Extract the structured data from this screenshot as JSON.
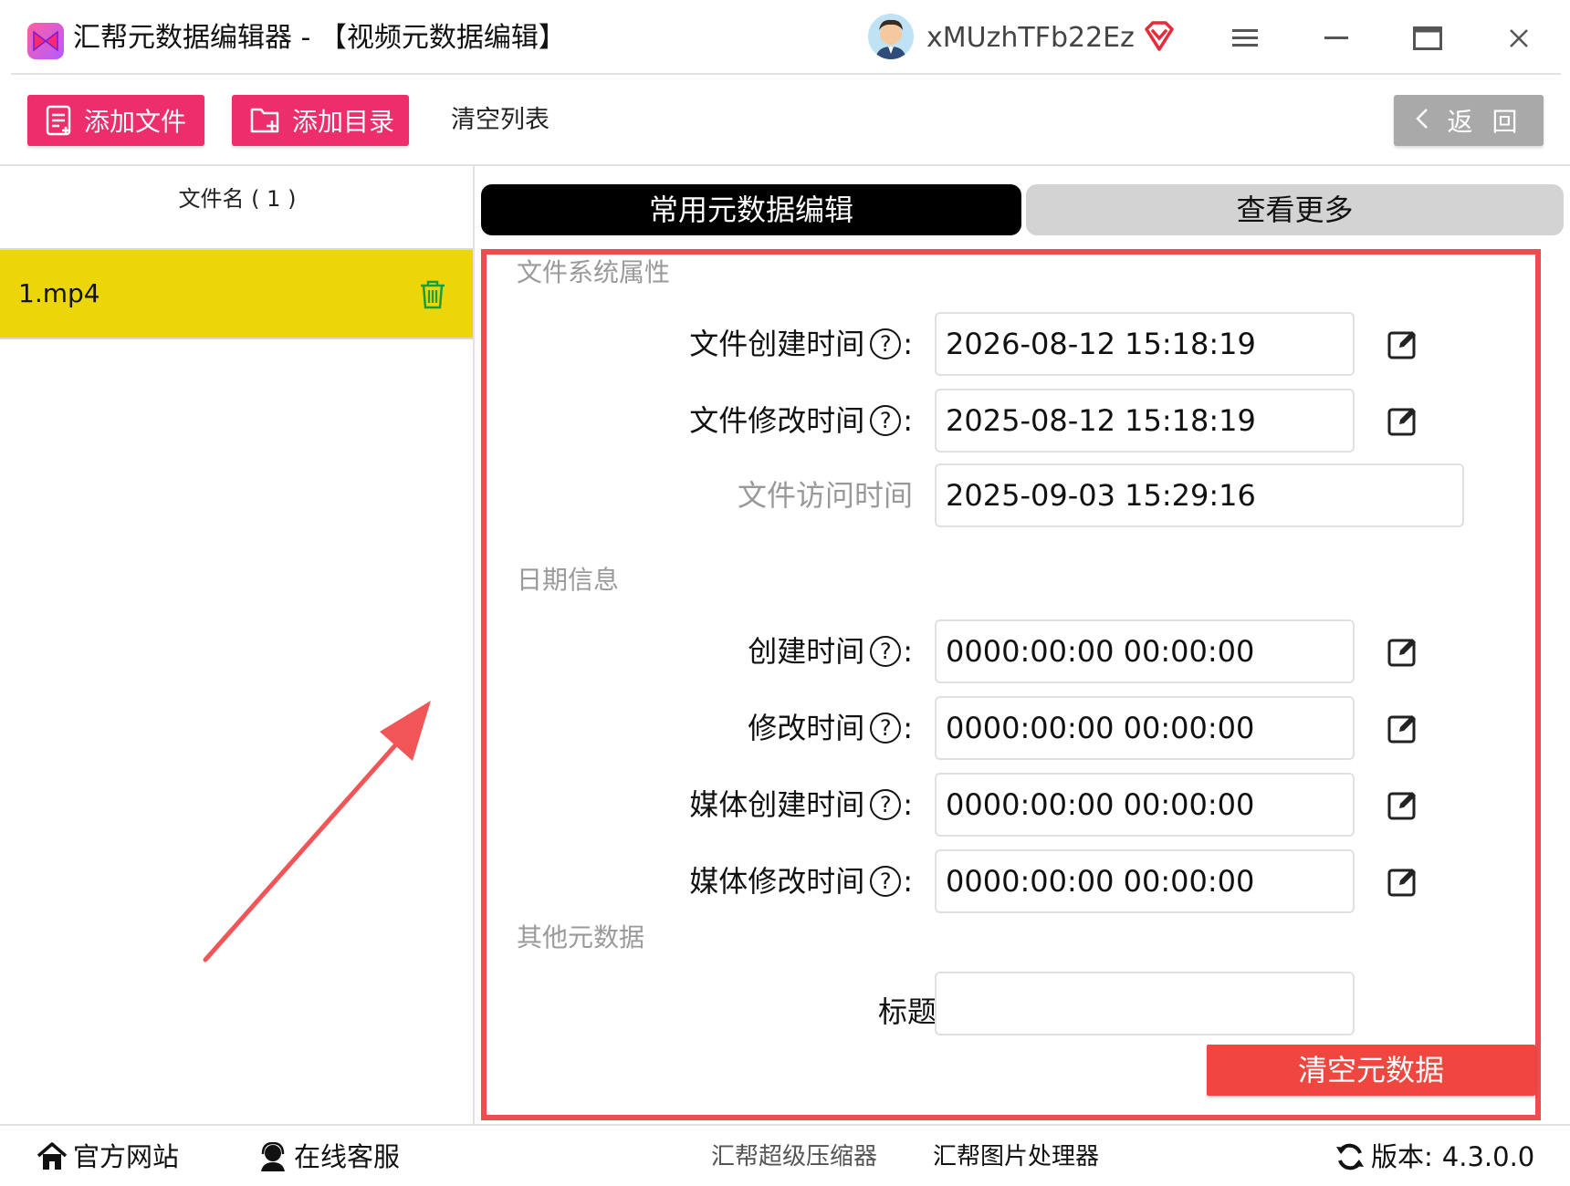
{
  "window": {
    "title": "汇帮元数据编辑器 - 【视频元数据编辑】",
    "username": "xMUzhTFb22Ez"
  },
  "toolbar": {
    "add_file": "添加文件",
    "add_folder": "添加目录",
    "clear_list": "清空列表",
    "back": "返 回"
  },
  "file_list": {
    "header": "文件名 ( 1 )",
    "items": [
      {
        "name": "1.mp4"
      }
    ]
  },
  "tabs": {
    "common": "常用元数据编辑",
    "more": "查看更多"
  },
  "sections": {
    "filesystem": {
      "title": "文件系统属性",
      "fields": [
        {
          "label": "文件创建时间",
          "value": "2026-08-12 15:18:19"
        },
        {
          "label": "文件修改时间",
          "value": "2025-08-12 15:18:19"
        },
        {
          "label": "文件访问时间",
          "value": "2025-09-03 15:29:16"
        }
      ]
    },
    "date": {
      "title": "日期信息",
      "fields": [
        {
          "label": "创建时间",
          "value": "0000:00:00 00:00:00"
        },
        {
          "label": "修改时间",
          "value": "0000:00:00 00:00:00"
        },
        {
          "label": "媒体创建时间",
          "value": "0000:00:00 00:00:00"
        },
        {
          "label": "媒体修改时间",
          "value": "0000:00:00 00:00:00"
        }
      ]
    },
    "other": {
      "title": "其他元数据",
      "fields": [
        {
          "label": "标题：",
          "value": ""
        }
      ]
    }
  },
  "qmark": "?",
  "colon": ":",
  "clear_metadata": "清空元数据",
  "footer": {
    "website": "官方网站",
    "support": "在线客服",
    "compressor": "汇帮超级压缩器",
    "image_tool": "汇帮图片处理器",
    "version_label": "版本:",
    "version": "4.3.0.0"
  },
  "colors": {
    "accent_pink": "#ee2d6c",
    "selected_row": "#ecd60a",
    "highlight_red": "#ef4c50",
    "clear_button": "#ef4640"
  }
}
